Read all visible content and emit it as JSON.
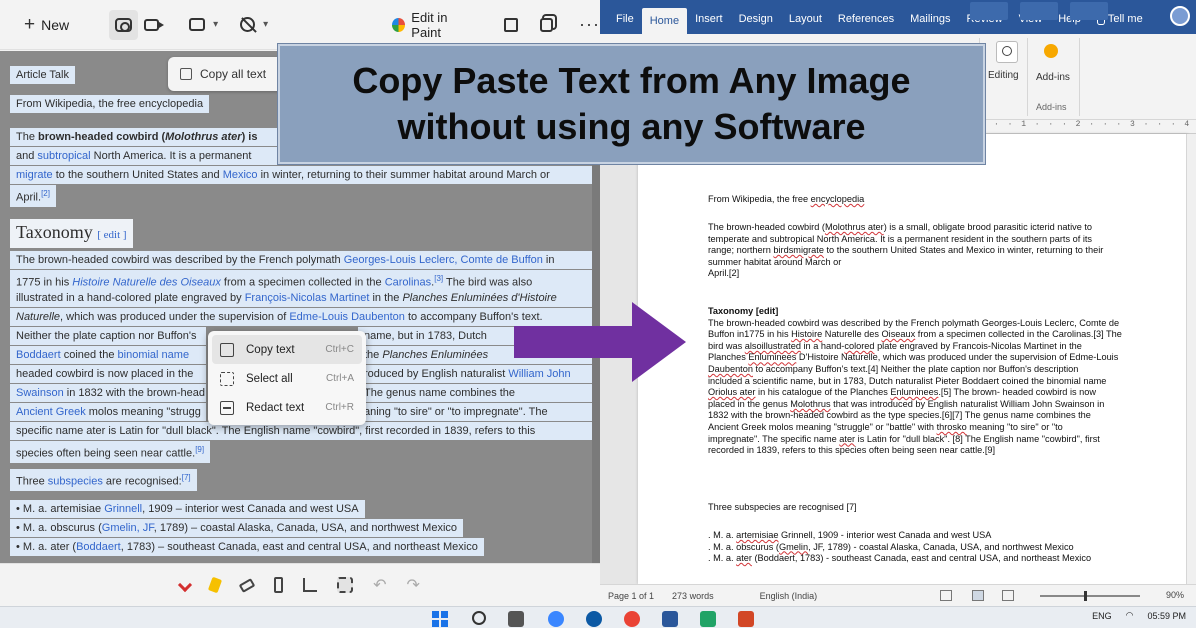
{
  "banner": {
    "line1": "Copy Paste Text from Any Image",
    "line2": "without using any Software"
  },
  "snipping_tool": {
    "toolbar": {
      "new_label": "New",
      "edit_in_paint_label": "Edit in Paint"
    },
    "copy_all_label": "Copy all text",
    "article": {
      "tabs": "Article   Talk",
      "source": "From Wikipedia, the free encyclopedia",
      "intro_line1_a": "The ",
      "intro_line1_b": "brown-headed cowbird",
      "intro_line1_c": " (",
      "intro_line1_d": "Molothrus ater",
      "intro_line1_e": ") is",
      "intro_line2_a": "and ",
      "intro_line2_b": "subtropical",
      "intro_line2_c": " North America. It is a permanent",
      "intro_line3_a": "migrate",
      "intro_line3_b": " to the southern United States and ",
      "intro_line3_c": "Mexico",
      "intro_line3_d": " in winter, returning to their summer habitat around March or",
      "intro_line4": "April.",
      "intro_line4_ref": "[2]",
      "taxonomy_heading": "Taxonomy",
      "edit_label": "[ edit ]",
      "tax_line1_a": "The brown-headed cowbird was described by the French polymath ",
      "tax_line1_b": "Georges-Louis Leclerc, Comte de Buffon",
      "tax_line1_c": " in",
      "tax_line2_a": "1775 in his ",
      "tax_line2_b": "Histoire Naturelle des Oiseaux",
      "tax_line2_c": " from a specimen collected in the ",
      "tax_line2_d": "Carolinas",
      "tax_line2_e": ".",
      "tax_line2_ref": "[3]",
      "tax_line2_f": " The bird was also",
      "tax_line3_a": "illustrated in a hand-colored plate engraved by ",
      "tax_line3_b": "François-Nicolas Martinet",
      "tax_line3_c": " in the ",
      "tax_line3_d": "Planches Enluminées d'Histoire",
      "tax_line4_a": "Naturelle",
      "tax_line4_b": ", which was produced under the supervision of ",
      "tax_line4_c": "Edme-Louis Daubenton",
      "tax_line4_d": " to accompany Buffon's text.",
      "tax_line5": "Neither the plate caption nor Buffon's",
      "tax_line5b": "name, but in 1783, Dutch",
      "tax_line6_a": "Boddaert",
      "tax_line6_b": " coined the ",
      "tax_line6_c": "binomial name",
      "tax_line6b": "the ",
      "tax_line6b_i": "Planches Enluminées",
      "tax_line7": "headed cowbird is now placed in the",
      "tax_line7b": "roduced by English naturalist ",
      "tax_line7b_l": "William John",
      "tax_line8_a": "Swainson",
      "tax_line8_b": " in 1832 with the brown-head",
      "tax_line8b": " The genus name combines the",
      "tax_line9_a": "Ancient Greek",
      "tax_line9_b": " molos meaning \"strugg",
      "tax_line9b": "aning \"to sire\" or \"to impregnate\". The",
      "tax_line10": "specific name ater is Latin for \"dull black\". The English name \"cowbird\", first recorded in 1839, refers to this",
      "tax_line11": "species often being seen near cattle.",
      "tax_line11_ref": "[9]",
      "subspecies_a": "Three ",
      "subspecies_b": "subspecies",
      "subspecies_c": " are recognised:",
      "subspecies_ref": "[7]",
      "b1_a": "• M. a. artemisiae ",
      "b1_b": "Grinnell",
      "b1_c": ", 1909 – interior west Canada and west USA",
      "b2_a": "• M. a. obscurus (",
      "b2_b": "Gmelin, JF",
      "b2_c": ", 1789) – coastal Alaska, Canada, USA, and northwest Mexico",
      "b3_a": "• M. a. ater (",
      "b3_b": "Boddaert",
      "b3_c": ", 1783) – southeast Canada, east and central USA, and northeast Mexico"
    },
    "context_menu": [
      {
        "label": "Copy text",
        "shortcut": "Ctrl+C"
      },
      {
        "label": "Select all",
        "shortcut": "Ctrl+A"
      },
      {
        "label": "Redact text",
        "shortcut": "Ctrl+R"
      }
    ]
  },
  "word": {
    "tabs": [
      "File",
      "Home",
      "Insert",
      "Design",
      "Layout",
      "References",
      "Mailings",
      "Review",
      "View",
      "Help",
      "Tell me"
    ],
    "ribbon": {
      "editing_label": "Editing",
      "addins_label": "Add-ins",
      "addins_group": "Add-ins"
    },
    "doc": {
      "source_a": "From Wikipedia, the free ",
      "source_b": "encyclopedia",
      "p1_a": "The brown-headed cowbird (",
      "p1_b": "Molothrus ater",
      "p1_c": ") is a small, obligate brood parasitic icterid native to",
      "p1_line2": "temperate and subtropical North America. It is a permanent resident in the southern parts of its",
      "p1_line3_a": "range; northern ",
      "p1_line3_b": "birdsmigrate",
      "p1_line3_c": " to the southern United States and Mexico in winter, returning to their",
      "p1_line4": "summer habitat around March or",
      "p1_line5": "April.[2]",
      "tax_title": "Taxonomy [edit]",
      "t1": "The brown-headed cowbird was described by the French polymath Georges-Louis Leclerc, Comte de",
      "t2_a": "Buffon in1775 in his ",
      "t2_b": "Histoire",
      "t2_c": " Naturelle des ",
      "t2_d": "Oiseaux",
      "t2_e": " from a specimen collected in the Carolinas.[3] The",
      "t3_a": "bird was ",
      "t3_b": "alsoillustrated",
      "t3_c": " in a hand-",
      "t3_d": "colored",
      "t3_e": " plate engraved by Francois-Nicolas Martinet in the",
      "t4_a": "Planches ",
      "t4_b": "Enluminees",
      "t4_c": " D'Histoire Naturelle, which was produced under the supervision of Edme-Louis",
      "t5_a": "Daubenton",
      "t5_b": " to accompany Buffon's text.[4] Neither the plate caption nor Buffon's description",
      "t6": "included a scientific name, but in 1783, Dutch naturalist Pieter Boddaert coined the binomial name",
      "t7_a": "Oriolus ater",
      "t7_b": " in his catalogue of the Planches ",
      "t7_c": "Enluminees",
      "t7_d": ".[5] The brown- headed cowbird is now",
      "t8_a": "placed in the genus ",
      "t8_b": "Molothrus",
      "t8_c": " that was introduced by English naturalist William John Swainson in",
      "t9": "1832 with the brown-headed cowbird as the type species.[6][7] The genus name combines the",
      "t10_a": "Ancient Greek molos meaning \"struggle\" or \"battle\" with ",
      "t10_b": "throsko",
      "t10_c": " meaning \"to sire\" or \"to",
      "t11_a": "impregnate\". The specific name ",
      "t11_b": "ater",
      "t11_c": " is Latin for \"dull black\". [8] The English name \"cowbird\", first",
      "t12": "recorded in 1839, refers to this species often being seen near cattle.[9]",
      "sub": "Three subspecies are recognised [7]",
      "s1_a": ". M. a. ",
      "s1_b": "artemisiae",
      "s1_c": " Grinnell, 1909 - interior west Canada and west USA",
      "s2_a": ". M. a. obscurus (",
      "s2_b": "Gmelin",
      "s2_c": ", JF, 1789) - coastal Alaska, Canada, USA, and northwest Mexico",
      "s3_a": ". M. a. ",
      "s3_b": "ater",
      "s3_c": " (Boddaert, 1783) - southeast Canada, east and central USA, and northeast Mexico"
    },
    "status": {
      "page": "Page 1 of 1",
      "words": "273 words",
      "language": "English (India)",
      "zoom": "90%"
    }
  },
  "taskbar": {
    "lang": "ENG",
    "time": "05:59 PM"
  },
  "colors": {
    "word_blue": "#2b579a",
    "arrow_purple": "#7030a0",
    "selection_blue": "#dde9f7",
    "link_blue": "#3366cc",
    "banner_bg": "#8aa0bd"
  }
}
